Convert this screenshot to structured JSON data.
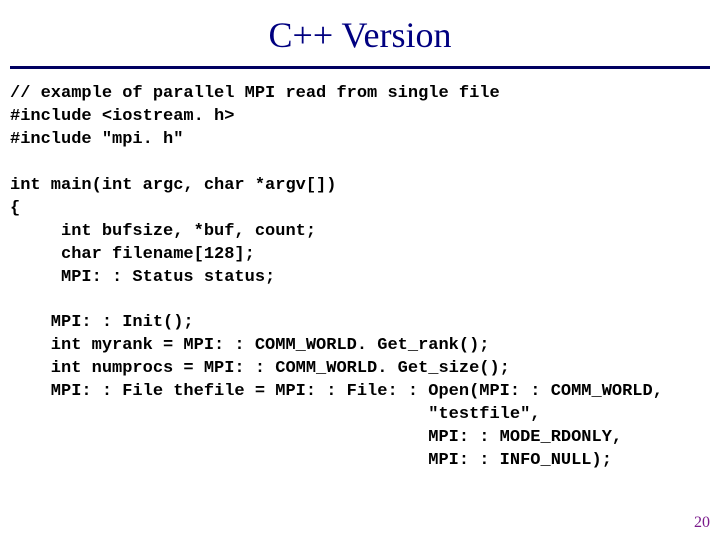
{
  "title": "C++ Version",
  "lines": {
    "l0": "// example of parallel MPI read from single file",
    "l1": "#include <iostream. h>",
    "l2": "#include \"mpi. h\"",
    "l3": "",
    "l4": "int main(int argc, char *argv[])",
    "l5": "{",
    "l6": "     int bufsize, *buf, count;",
    "l7": "     char filename[128];",
    "l8": "     MPI: : Status status;",
    "l9": "",
    "l10": "    MPI: : Init();",
    "l11": "    int myrank = MPI: : COMM_WORLD. Get_rank();",
    "l12": "    int numprocs = MPI: : COMM_WORLD. Get_size();",
    "l13": "    MPI: : File thefile = MPI: : File: : Open(MPI: : COMM_WORLD,",
    "l14": "                                         \"testfile\",",
    "l15": "                                         MPI: : MODE_RDONLY,",
    "l16": "                                         MPI: : INFO_NULL);"
  },
  "page_number": "20"
}
